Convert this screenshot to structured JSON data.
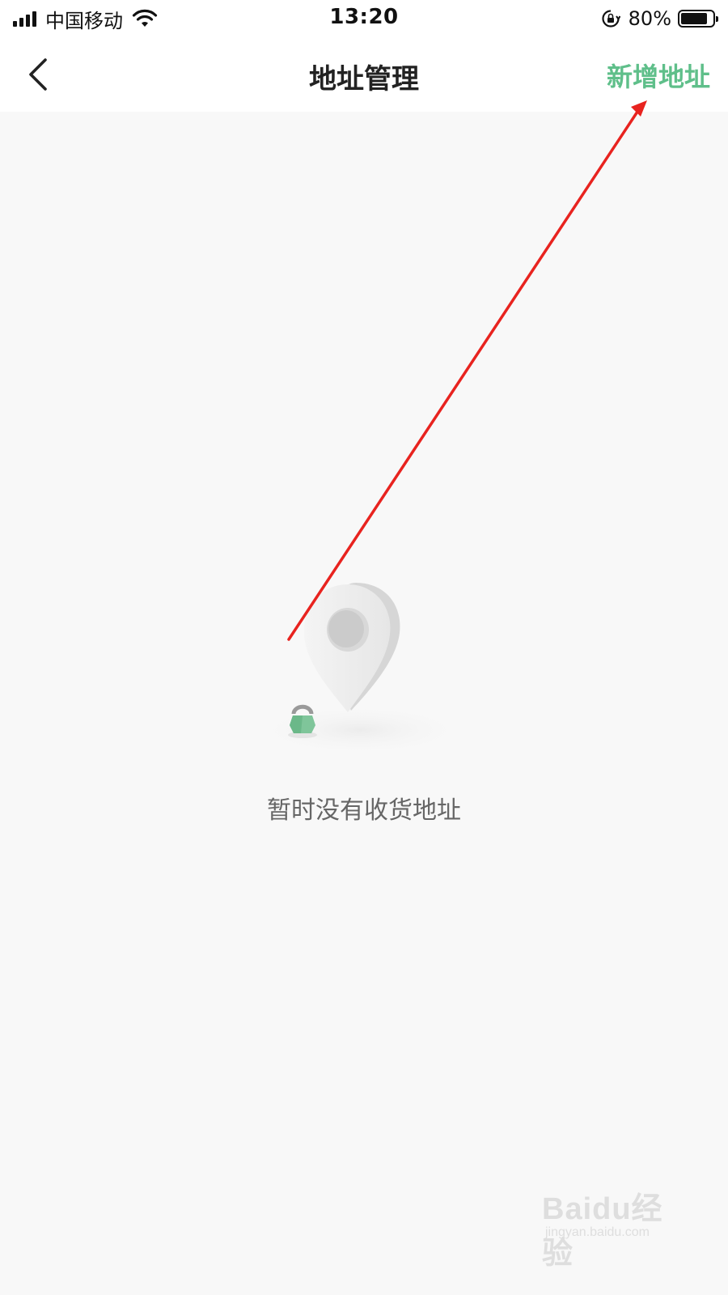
{
  "status_bar": {
    "carrier": "中国移动",
    "time": "13:20",
    "battery": "80%",
    "battery_level": 0.8
  },
  "nav": {
    "title": "地址管理",
    "add_label": "新增地址"
  },
  "empty_state": {
    "message": "暂时没有收货地址",
    "icon": "map-pin-icon"
  },
  "watermark": {
    "brand": "Baidu经验",
    "url": "jingyan.baidu.com"
  },
  "colors": {
    "accent": "#5fbf8a",
    "background": "#f8f8f8",
    "annotation": "#e8231f"
  }
}
